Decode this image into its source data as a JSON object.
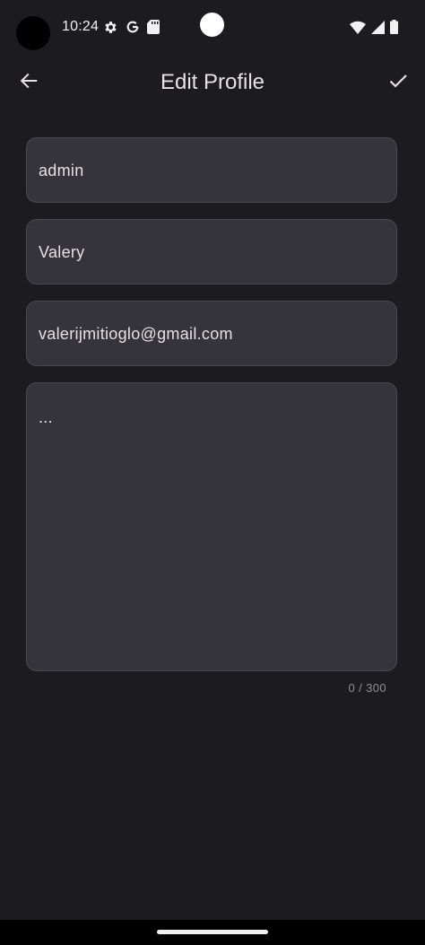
{
  "status_bar": {
    "time": "10:24",
    "left_icons": [
      "settings-gear-icon",
      "google-g-icon",
      "sd-card-icon"
    ],
    "right_icons": [
      "wifi-icon",
      "cell-signal-icon",
      "battery-icon"
    ]
  },
  "app_bar": {
    "title": "Edit Profile",
    "back_icon": "arrow-back-icon",
    "confirm_icon": "check-icon"
  },
  "form": {
    "username": {
      "value": "admin"
    },
    "name": {
      "value": "Valery"
    },
    "email": {
      "value": "valerijmitioglo@gmail.com"
    },
    "bio": {
      "value": "...",
      "counter": "0 / 300"
    }
  },
  "colors": {
    "background": "#1c1b20",
    "field_fill": "#36343b",
    "field_border": "#4a4850",
    "text_primary": "#e6e1e5",
    "text_secondary": "#938f99"
  }
}
